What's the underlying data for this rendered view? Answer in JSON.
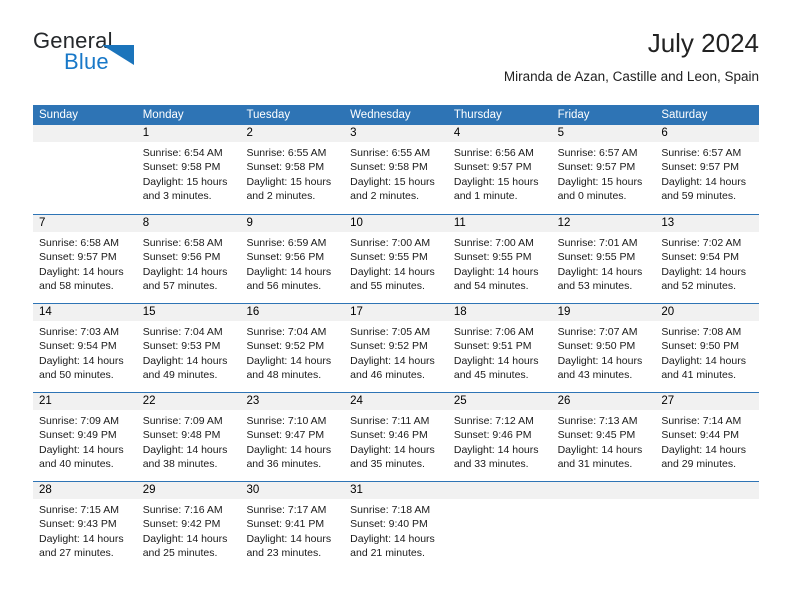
{
  "brand": {
    "name_top": "General",
    "name_bottom": "Blue",
    "triangle_color": "#1b74bb",
    "top_color": "#25282b",
    "bottom_color": "#1878c8"
  },
  "header": {
    "title": "July 2024",
    "subtitle": "Miranda de Azan, Castille and Leon, Spain"
  },
  "colors": {
    "header_blue": "#2e74b5",
    "day_band_gray": "#f1f1f1",
    "text": "#1a1a1a"
  },
  "weekdays": [
    "Sunday",
    "Monday",
    "Tuesday",
    "Wednesday",
    "Thursday",
    "Friday",
    "Saturday"
  ],
  "weeks": [
    [
      {
        "day": "",
        "sunrise": "",
        "sunset": "",
        "daylight": "",
        "daylight2": ""
      },
      {
        "day": "1",
        "sunrise": "Sunrise: 6:54 AM",
        "sunset": "Sunset: 9:58 PM",
        "daylight": "Daylight: 15 hours",
        "daylight2": "and 3 minutes."
      },
      {
        "day": "2",
        "sunrise": "Sunrise: 6:55 AM",
        "sunset": "Sunset: 9:58 PM",
        "daylight": "Daylight: 15 hours",
        "daylight2": "and 2 minutes."
      },
      {
        "day": "3",
        "sunrise": "Sunrise: 6:55 AM",
        "sunset": "Sunset: 9:58 PM",
        "daylight": "Daylight: 15 hours",
        "daylight2": "and 2 minutes."
      },
      {
        "day": "4",
        "sunrise": "Sunrise: 6:56 AM",
        "sunset": "Sunset: 9:57 PM",
        "daylight": "Daylight: 15 hours",
        "daylight2": "and 1 minute."
      },
      {
        "day": "5",
        "sunrise": "Sunrise: 6:57 AM",
        "sunset": "Sunset: 9:57 PM",
        "daylight": "Daylight: 15 hours",
        "daylight2": "and 0 minutes."
      },
      {
        "day": "6",
        "sunrise": "Sunrise: 6:57 AM",
        "sunset": "Sunset: 9:57 PM",
        "daylight": "Daylight: 14 hours",
        "daylight2": "and 59 minutes."
      }
    ],
    [
      {
        "day": "7",
        "sunrise": "Sunrise: 6:58 AM",
        "sunset": "Sunset: 9:57 PM",
        "daylight": "Daylight: 14 hours",
        "daylight2": "and 58 minutes."
      },
      {
        "day": "8",
        "sunrise": "Sunrise: 6:58 AM",
        "sunset": "Sunset: 9:56 PM",
        "daylight": "Daylight: 14 hours",
        "daylight2": "and 57 minutes."
      },
      {
        "day": "9",
        "sunrise": "Sunrise: 6:59 AM",
        "sunset": "Sunset: 9:56 PM",
        "daylight": "Daylight: 14 hours",
        "daylight2": "and 56 minutes."
      },
      {
        "day": "10",
        "sunrise": "Sunrise: 7:00 AM",
        "sunset": "Sunset: 9:55 PM",
        "daylight": "Daylight: 14 hours",
        "daylight2": "and 55 minutes."
      },
      {
        "day": "11",
        "sunrise": "Sunrise: 7:00 AM",
        "sunset": "Sunset: 9:55 PM",
        "daylight": "Daylight: 14 hours",
        "daylight2": "and 54 minutes."
      },
      {
        "day": "12",
        "sunrise": "Sunrise: 7:01 AM",
        "sunset": "Sunset: 9:55 PM",
        "daylight": "Daylight: 14 hours",
        "daylight2": "and 53 minutes."
      },
      {
        "day": "13",
        "sunrise": "Sunrise: 7:02 AM",
        "sunset": "Sunset: 9:54 PM",
        "daylight": "Daylight: 14 hours",
        "daylight2": "and 52 minutes."
      }
    ],
    [
      {
        "day": "14",
        "sunrise": "Sunrise: 7:03 AM",
        "sunset": "Sunset: 9:54 PM",
        "daylight": "Daylight: 14 hours",
        "daylight2": "and 50 minutes."
      },
      {
        "day": "15",
        "sunrise": "Sunrise: 7:04 AM",
        "sunset": "Sunset: 9:53 PM",
        "daylight": "Daylight: 14 hours",
        "daylight2": "and 49 minutes."
      },
      {
        "day": "16",
        "sunrise": "Sunrise: 7:04 AM",
        "sunset": "Sunset: 9:52 PM",
        "daylight": "Daylight: 14 hours",
        "daylight2": "and 48 minutes."
      },
      {
        "day": "17",
        "sunrise": "Sunrise: 7:05 AM",
        "sunset": "Sunset: 9:52 PM",
        "daylight": "Daylight: 14 hours",
        "daylight2": "and 46 minutes."
      },
      {
        "day": "18",
        "sunrise": "Sunrise: 7:06 AM",
        "sunset": "Sunset: 9:51 PM",
        "daylight": "Daylight: 14 hours",
        "daylight2": "and 45 minutes."
      },
      {
        "day": "19",
        "sunrise": "Sunrise: 7:07 AM",
        "sunset": "Sunset: 9:50 PM",
        "daylight": "Daylight: 14 hours",
        "daylight2": "and 43 minutes."
      },
      {
        "day": "20",
        "sunrise": "Sunrise: 7:08 AM",
        "sunset": "Sunset: 9:50 PM",
        "daylight": "Daylight: 14 hours",
        "daylight2": "and 41 minutes."
      }
    ],
    [
      {
        "day": "21",
        "sunrise": "Sunrise: 7:09 AM",
        "sunset": "Sunset: 9:49 PM",
        "daylight": "Daylight: 14 hours",
        "daylight2": "and 40 minutes."
      },
      {
        "day": "22",
        "sunrise": "Sunrise: 7:09 AM",
        "sunset": "Sunset: 9:48 PM",
        "daylight": "Daylight: 14 hours",
        "daylight2": "and 38 minutes."
      },
      {
        "day": "23",
        "sunrise": "Sunrise: 7:10 AM",
        "sunset": "Sunset: 9:47 PM",
        "daylight": "Daylight: 14 hours",
        "daylight2": "and 36 minutes."
      },
      {
        "day": "24",
        "sunrise": "Sunrise: 7:11 AM",
        "sunset": "Sunset: 9:46 PM",
        "daylight": "Daylight: 14 hours",
        "daylight2": "and 35 minutes."
      },
      {
        "day": "25",
        "sunrise": "Sunrise: 7:12 AM",
        "sunset": "Sunset: 9:46 PM",
        "daylight": "Daylight: 14 hours",
        "daylight2": "and 33 minutes."
      },
      {
        "day": "26",
        "sunrise": "Sunrise: 7:13 AM",
        "sunset": "Sunset: 9:45 PM",
        "daylight": "Daylight: 14 hours",
        "daylight2": "and 31 minutes."
      },
      {
        "day": "27",
        "sunrise": "Sunrise: 7:14 AM",
        "sunset": "Sunset: 9:44 PM",
        "daylight": "Daylight: 14 hours",
        "daylight2": "and 29 minutes."
      }
    ],
    [
      {
        "day": "28",
        "sunrise": "Sunrise: 7:15 AM",
        "sunset": "Sunset: 9:43 PM",
        "daylight": "Daylight: 14 hours",
        "daylight2": "and 27 minutes."
      },
      {
        "day": "29",
        "sunrise": "Sunrise: 7:16 AM",
        "sunset": "Sunset: 9:42 PM",
        "daylight": "Daylight: 14 hours",
        "daylight2": "and 25 minutes."
      },
      {
        "day": "30",
        "sunrise": "Sunrise: 7:17 AM",
        "sunset": "Sunset: 9:41 PM",
        "daylight": "Daylight: 14 hours",
        "daylight2": "and 23 minutes."
      },
      {
        "day": "31",
        "sunrise": "Sunrise: 7:18 AM",
        "sunset": "Sunset: 9:40 PM",
        "daylight": "Daylight: 14 hours",
        "daylight2": "and 21 minutes."
      },
      {
        "day": "",
        "sunrise": "",
        "sunset": "",
        "daylight": "",
        "daylight2": ""
      },
      {
        "day": "",
        "sunrise": "",
        "sunset": "",
        "daylight": "",
        "daylight2": ""
      },
      {
        "day": "",
        "sunrise": "",
        "sunset": "",
        "daylight": "",
        "daylight2": ""
      }
    ]
  ]
}
